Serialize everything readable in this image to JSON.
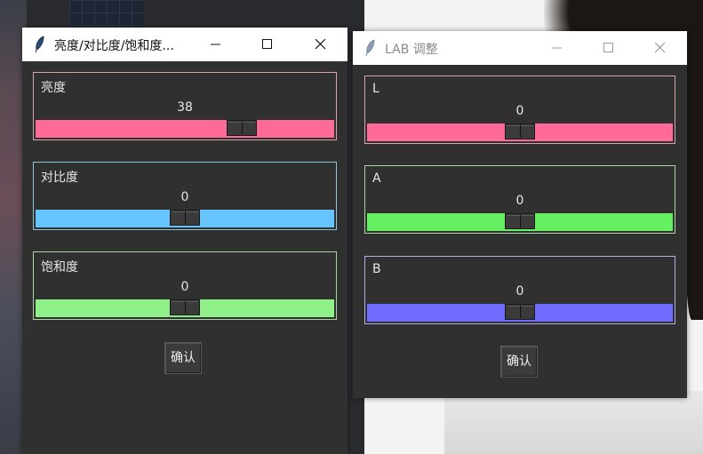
{
  "window_left": {
    "title": "亮度/对比度/饱和度...",
    "groups": [
      {
        "label": "亮度",
        "value": "38",
        "fraction": 0.69,
        "border": "#d9a3a8",
        "color": "#ff6b98"
      },
      {
        "label": "对比度",
        "value": "0",
        "fraction": 0.5,
        "border": "#8cc6df",
        "color": "#66c5ff"
      },
      {
        "label": "饱和度",
        "value": "0",
        "fraction": 0.5,
        "border": "#a7d9a1",
        "color": "#8ff08a"
      }
    ],
    "confirm_label": "确认"
  },
  "window_right": {
    "title": "LAB 调整",
    "groups": [
      {
        "label": "L",
        "value": "0",
        "fraction": 0.5,
        "border": "#d9a3a8",
        "color": "#ff6b98"
      },
      {
        "label": "A",
        "value": "0",
        "fraction": 0.5,
        "border": "#a7d9a1",
        "color": "#64f060"
      },
      {
        "label": "B",
        "value": "0",
        "fraction": 0.5,
        "border": "#b3b0e6",
        "color": "#6f6bff"
      }
    ],
    "confirm_label": "确认"
  },
  "icons": {
    "app": "feather-icon",
    "minimize": "minimize-icon",
    "maximize": "maximize-icon",
    "close": "close-icon"
  }
}
